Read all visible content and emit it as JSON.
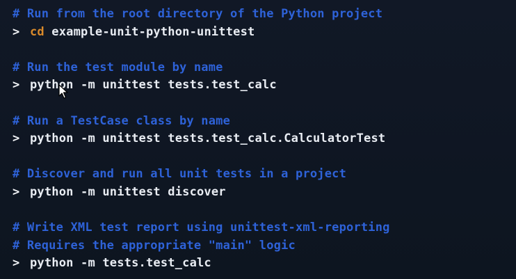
{
  "prompt_symbol": ">",
  "blocks": [
    {
      "comments": [
        "# Run from the root directory of the Python project"
      ],
      "command_keyword": "cd",
      "command_rest": " example-unit-python-unittest"
    },
    {
      "comments": [
        "# Run the test module by name"
      ],
      "command_keyword": "",
      "command_rest": "python -m unittest tests.test_calc"
    },
    {
      "comments": [
        "# Run a TestCase class by name"
      ],
      "command_keyword": "",
      "command_rest": "python -m unittest tests.test_calc.CalculatorTest"
    },
    {
      "comments": [
        "# Discover and run all unit tests in a project"
      ],
      "command_keyword": "",
      "command_rest": "python -m unittest discover"
    },
    {
      "comments": [
        "# Write XML test report using unittest-xml-reporting",
        "# Requires the appropriate \"main\" logic"
      ],
      "command_keyword": "",
      "command_rest": "python -m tests.test_calc"
    }
  ],
  "colors": {
    "background": "#0f1621",
    "comment": "#2e62d8",
    "command": "#e9edf3",
    "keyword": "#d98a2b"
  },
  "icons": {
    "cursor": "mouse-pointer-icon"
  }
}
